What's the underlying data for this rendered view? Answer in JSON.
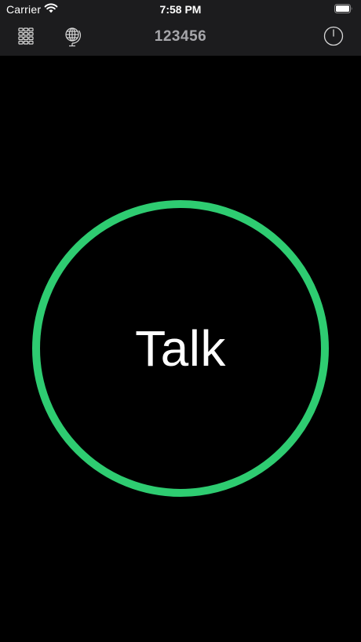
{
  "status_bar": {
    "carrier": "Carrier",
    "time": "7:58 PM",
    "wifi_icon": "wifi-icon",
    "battery_icon": "battery-full-icon"
  },
  "nav_bar": {
    "title": "123456",
    "left_icons": [
      "keypad-icon",
      "globe-icon"
    ],
    "right_icon": "power-icon"
  },
  "main": {
    "talk_label": "Talk"
  },
  "colors": {
    "accent": "#2ecc71",
    "background": "#000000",
    "bar_background": "#1c1c1e",
    "nav_title": "#a6a6aa",
    "icon": "#d8d8d8"
  }
}
